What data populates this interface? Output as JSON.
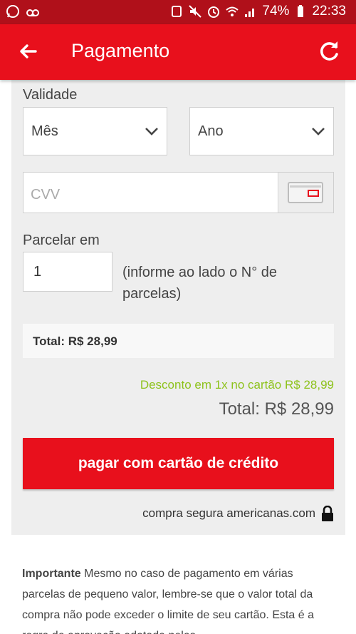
{
  "status_bar": {
    "battery": "74%",
    "time": "22:33",
    "icons": [
      "whatsapp-icon",
      "voicemail-icon",
      "alarm-app-icon",
      "mute-icon",
      "alarm-icon",
      "wifi-icon",
      "signal-icon",
      "battery-icon"
    ]
  },
  "appbar": {
    "title": "Pagamento",
    "back_icon": "arrow-left-icon",
    "refresh_icon": "refresh-icon"
  },
  "form": {
    "validity_label": "Validade",
    "month_value": "Mês",
    "year_value": "Ano",
    "cvv_placeholder": "CVV",
    "installments_label": "Parcelar em",
    "installments_value": "1",
    "installments_help": "(informe ao lado o N° de parcelas)",
    "total_box": "Total: R$ 28,99",
    "discount_text": "Desconto em 1x no cartão R$ 28,99",
    "total_text": "Total: R$ 28,99",
    "pay_button": "pagar com cartão de crédito",
    "secure_text": "compra segura americanas.com"
  },
  "notice": {
    "title": "Importante",
    "text": "Mesmo no caso de pagamento em várias parcelas de pequeno valor, lembre-se que o valor total da compra não pode exceder o limite de seu cartão. Esta é a regra de aprovação adotada pelas"
  },
  "colors": {
    "status_bar": "#b0101a",
    "brand_red": "#e8101c",
    "discount_green": "#8dc21b",
    "card_bg": "#eeeeee"
  }
}
